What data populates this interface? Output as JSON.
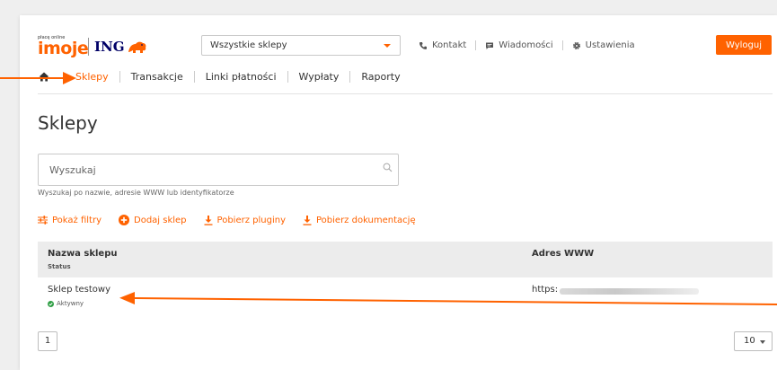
{
  "header": {
    "logo_small": "płacę online",
    "logo_brand": "imoje",
    "logo_partner": "ING",
    "store_select": {
      "value": "Wszystkie sklepy"
    },
    "links": [
      {
        "label": "Kontakt",
        "icon": "phone-icon"
      },
      {
        "label": "Wiadomości",
        "icon": "message-icon"
      },
      {
        "label": "Ustawienia",
        "icon": "gear-icon"
      }
    ],
    "logout_label": "Wyloguj"
  },
  "nav": {
    "home_icon": "home-icon",
    "items": [
      {
        "label": "Sklepy",
        "active": true
      },
      {
        "label": "Transakcje"
      },
      {
        "label": "Linki płatności"
      },
      {
        "label": "Wypłaty"
      },
      {
        "label": "Raporty"
      }
    ]
  },
  "page": {
    "title": "Sklepy",
    "search": {
      "placeholder": "Wyszukaj",
      "hint": "Wyszukaj po nazwie, adresie WWW lub identyfikatorze"
    },
    "actions": [
      {
        "label": "Pokaż filtry",
        "icon": "filter-icon"
      },
      {
        "label": "Dodaj sklep",
        "icon": "plus-circle-icon"
      },
      {
        "label": "Pobierz pluginy",
        "icon": "download-icon"
      },
      {
        "label": "Pobierz dokumentację",
        "icon": "download-icon"
      }
    ]
  },
  "table": {
    "columns": {
      "name": "Nazwa sklepu",
      "status": "Status",
      "www": "Adres WWW"
    },
    "rows": [
      {
        "name": "Sklep testowy",
        "status": "Aktywny",
        "url": "https:"
      }
    ]
  },
  "pagination": {
    "page": "1",
    "per_page": "10"
  },
  "colors": {
    "accent": "#ff6200",
    "brand_navy": "#000066",
    "status_active": "#2e9e44",
    "annotation_arrow": "#ff6200"
  }
}
